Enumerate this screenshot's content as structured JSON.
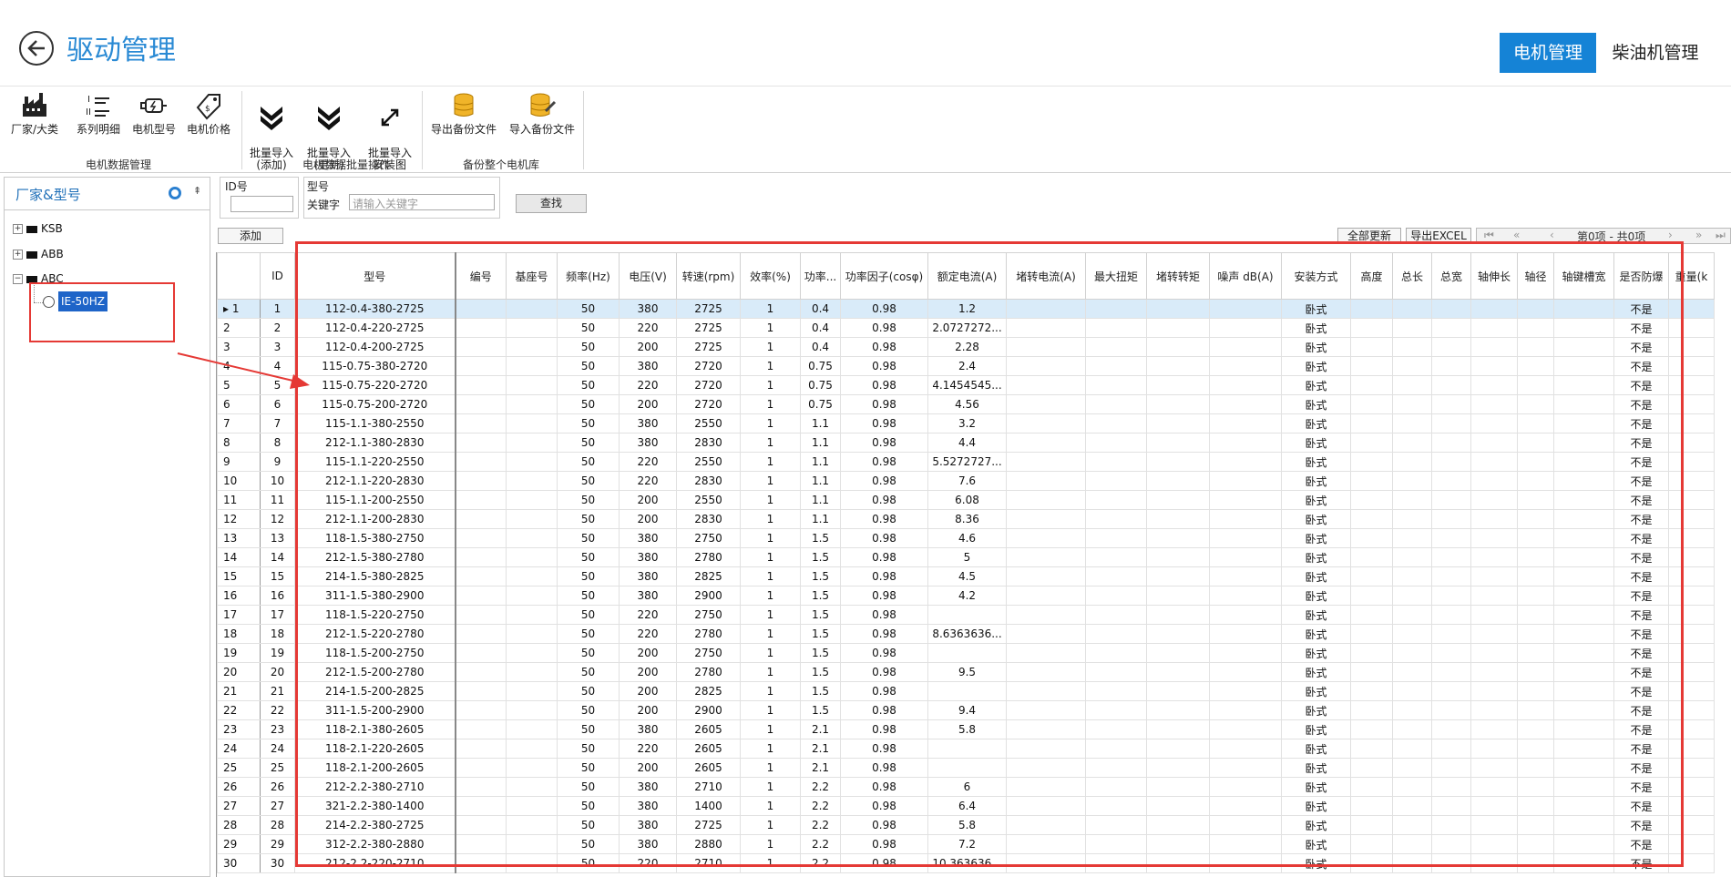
{
  "header": {
    "title": "驱动管理",
    "tabs": [
      {
        "label": "电机管理"
      },
      {
        "label": "柴油机管理"
      }
    ]
  },
  "ribbon": {
    "groups": [
      {
        "label": "电机数据管理",
        "buttons": [
          "厂家/大类",
          "系列明细",
          "电机型号",
          "电机价格"
        ]
      },
      {
        "label": "电机数据批量操作",
        "buttons": [
          "批量导入\n(添加)",
          "批量导入\n(更新)",
          "批量导入\n安装图"
        ]
      },
      {
        "label": "备份整个电机库",
        "buttons": [
          "导出备份文件",
          "导入备份文件"
        ]
      }
    ]
  },
  "left_panel": {
    "title": "厂家&型号",
    "tree": [
      {
        "label": "KSB"
      },
      {
        "label": "ABB"
      },
      {
        "label": "ABC"
      }
    ],
    "selected_child": "IE-50HZ"
  },
  "search": {
    "id_label": "ID号",
    "model_label": "型号",
    "keyword_label": "关键字",
    "keyword_placeholder": "请输入关键字",
    "search_button": "查找"
  },
  "grid_toolbar": {
    "add": "添加",
    "refresh_all": "全部更新",
    "export_excel": "导出EXCEL",
    "pager": "第0项 - 共0项"
  },
  "table": {
    "columns": [
      "ID",
      "型号",
      "编号",
      "基座号",
      "频率(Hz)",
      "电压(V)",
      "转速(rpm)",
      "效率(%)",
      "功率...",
      "功率因子(cosφ)",
      "额定电流(A)",
      "堵转电流(A)",
      "最大扭矩",
      "堵转转矩",
      "噪声 dB(A)",
      "安装方式",
      "高度",
      "总长",
      "总宽",
      "轴伸长",
      "轴径",
      "轴键槽宽",
      "是否防爆",
      "重量(k"
    ],
    "rows": [
      [
        "1",
        "1",
        "112-0.4-380-2725",
        "50",
        "380",
        "2725",
        "1",
        "0.4",
        "0.98",
        "1.2"
      ],
      [
        "2",
        "2",
        "112-0.4-220-2725",
        "50",
        "220",
        "2725",
        "1",
        "0.4",
        "0.98",
        "2.0727272..."
      ],
      [
        "3",
        "3",
        "112-0.4-200-2725",
        "50",
        "200",
        "2725",
        "1",
        "0.4",
        "0.98",
        "2.28"
      ],
      [
        "4",
        "4",
        "115-0.75-380-2720",
        "50",
        "380",
        "2720",
        "1",
        "0.75",
        "0.98",
        "2.4"
      ],
      [
        "5",
        "5",
        "115-0.75-220-2720",
        "50",
        "220",
        "2720",
        "1",
        "0.75",
        "0.98",
        "4.1454545..."
      ],
      [
        "6",
        "6",
        "115-0.75-200-2720",
        "50",
        "200",
        "2720",
        "1",
        "0.75",
        "0.98",
        "4.56"
      ],
      [
        "7",
        "7",
        "115-1.1-380-2550",
        "50",
        "380",
        "2550",
        "1",
        "1.1",
        "0.98",
        "3.2"
      ],
      [
        "8",
        "8",
        "212-1.1-380-2830",
        "50",
        "380",
        "2830",
        "1",
        "1.1",
        "0.98",
        "4.4"
      ],
      [
        "9",
        "9",
        "115-1.1-220-2550",
        "50",
        "220",
        "2550",
        "1",
        "1.1",
        "0.98",
        "5.5272727..."
      ],
      [
        "10",
        "10",
        "212-1.1-220-2830",
        "50",
        "220",
        "2830",
        "1",
        "1.1",
        "0.98",
        "7.6"
      ],
      [
        "11",
        "11",
        "115-1.1-200-2550",
        "50",
        "200",
        "2550",
        "1",
        "1.1",
        "0.98",
        "6.08"
      ],
      [
        "12",
        "12",
        "212-1.1-200-2830",
        "50",
        "200",
        "2830",
        "1",
        "1.1",
        "0.98",
        "8.36"
      ],
      [
        "13",
        "13",
        "118-1.5-380-2750",
        "50",
        "380",
        "2750",
        "1",
        "1.5",
        "0.98",
        "4.6"
      ],
      [
        "14",
        "14",
        "212-1.5-380-2780",
        "50",
        "380",
        "2780",
        "1",
        "1.5",
        "0.98",
        "5"
      ],
      [
        "15",
        "15",
        "214-1.5-380-2825",
        "50",
        "380",
        "2825",
        "1",
        "1.5",
        "0.98",
        "4.5"
      ],
      [
        "16",
        "16",
        "311-1.5-380-2900",
        "50",
        "380",
        "2900",
        "1",
        "1.5",
        "0.98",
        "4.2"
      ],
      [
        "17",
        "17",
        "118-1.5-220-2750",
        "50",
        "220",
        "2750",
        "1",
        "1.5",
        "0.98",
        ""
      ],
      [
        "18",
        "18",
        "212-1.5-220-2780",
        "50",
        "220",
        "2780",
        "1",
        "1.5",
        "0.98",
        "8.6363636..."
      ],
      [
        "19",
        "19",
        "118-1.5-200-2750",
        "50",
        "200",
        "2750",
        "1",
        "1.5",
        "0.98",
        ""
      ],
      [
        "20",
        "20",
        "212-1.5-200-2780",
        "50",
        "200",
        "2780",
        "1",
        "1.5",
        "0.98",
        "9.5"
      ],
      [
        "21",
        "21",
        "214-1.5-200-2825",
        "50",
        "200",
        "2825",
        "1",
        "1.5",
        "0.98",
        ""
      ],
      [
        "22",
        "22",
        "311-1.5-200-2900",
        "50",
        "200",
        "2900",
        "1",
        "1.5",
        "0.98",
        "9.4"
      ],
      [
        "23",
        "23",
        "118-2.1-380-2605",
        "50",
        "380",
        "2605",
        "1",
        "2.1",
        "0.98",
        "5.8"
      ],
      [
        "24",
        "24",
        "118-2.1-220-2605",
        "50",
        "220",
        "2605",
        "1",
        "2.1",
        "0.98",
        ""
      ],
      [
        "25",
        "25",
        "118-2.1-200-2605",
        "50",
        "200",
        "2605",
        "1",
        "2.1",
        "0.98",
        ""
      ],
      [
        "26",
        "26",
        "212-2.2-380-2710",
        "50",
        "380",
        "2710",
        "1",
        "2.2",
        "0.98",
        "6"
      ],
      [
        "27",
        "27",
        "321-2.2-380-1400",
        "50",
        "380",
        "1400",
        "1",
        "2.2",
        "0.98",
        "6.4"
      ],
      [
        "28",
        "28",
        "214-2.2-380-2725",
        "50",
        "380",
        "2725",
        "1",
        "2.2",
        "0.98",
        "5.8"
      ],
      [
        "29",
        "29",
        "312-2.2-380-2880",
        "50",
        "380",
        "2880",
        "1",
        "2.2",
        "0.98",
        "7.2"
      ],
      [
        "30",
        "30",
        "212-2.2-220-2710",
        "50",
        "220",
        "2710",
        "1",
        "2.2",
        "0.98",
        "10.363636..."
      ]
    ],
    "install_type": "卧式",
    "explosion_proof": "不是"
  },
  "colors": {
    "accent": "#1583d6",
    "annotation": "#e53935"
  }
}
